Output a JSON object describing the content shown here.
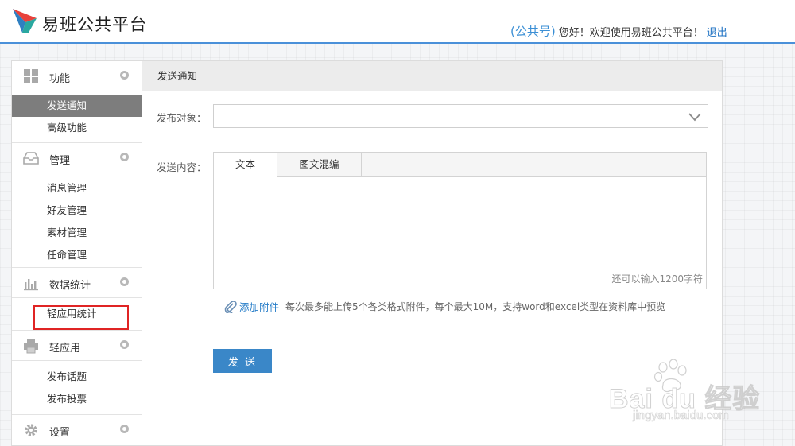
{
  "header": {
    "brand": "易班公共平台",
    "account_name": "(公共号)",
    "greeting": "您好！欢迎使用易班公共平台！",
    "logout": "退出"
  },
  "sidebar": {
    "groups": [
      {
        "label": "功能",
        "icon": "grid-icon",
        "items": [
          "发送通知",
          "高级功能"
        ],
        "active_item": "发送通知"
      },
      {
        "label": "管理",
        "icon": "inbox-icon",
        "items": [
          "消息管理",
          "好友管理",
          "素材管理",
          "任命管理"
        ],
        "highlighted_item": "任命管理"
      },
      {
        "label": "数据统计",
        "icon": "bar-chart-icon",
        "items": [
          "轻应用统计"
        ]
      },
      {
        "label": "轻应用",
        "icon": "printer-icon",
        "items": [
          "发布话题",
          "发布投票"
        ]
      },
      {
        "label": "设置",
        "icon": "gear-icon",
        "items": []
      }
    ]
  },
  "main": {
    "title": "发送通知",
    "target_label": "发布对象：",
    "target_value": "",
    "content_label": "发送内容：",
    "tabs": [
      "文本",
      "图文混编"
    ],
    "active_tab": "文本",
    "char_count": "还可以输入1200字符",
    "attach_label": "添加附件",
    "attach_hint": "每次最多能上传5个各类格式附件，每个最大10M，支持word和excel类型在资料库中预览",
    "send_label": "发 送"
  },
  "watermark": {
    "main": "Bai du 经验",
    "sub": "jingyan.baidu.com"
  },
  "colors": {
    "accent": "#3a87c8",
    "header_line": "#4a90d9",
    "active_item_bg": "#7d7d7d",
    "highlight": "#e02424",
    "link": "#2a7fc9"
  }
}
